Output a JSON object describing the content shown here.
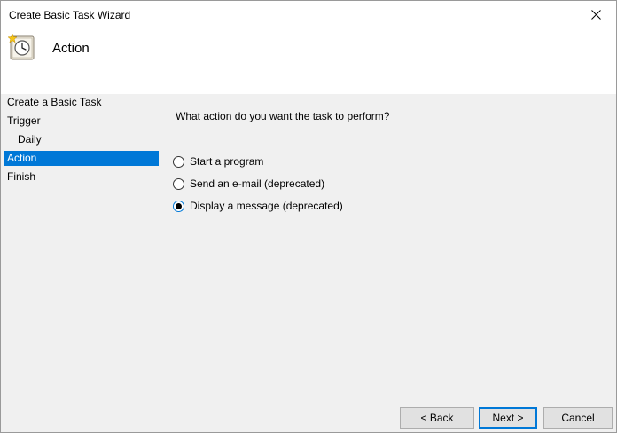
{
  "window": {
    "title": "Create Basic Task Wizard"
  },
  "header": {
    "title": "Action",
    "icon": "task-scheduler-clock-icon"
  },
  "sidebar": {
    "items": [
      {
        "label": "Create a Basic Task",
        "active": false
      },
      {
        "label": "Trigger",
        "active": false
      },
      {
        "label": "Daily",
        "active": false,
        "indent": true
      },
      {
        "label": "Action",
        "active": true
      },
      {
        "label": "Finish",
        "active": false
      }
    ]
  },
  "main": {
    "question": "What action do you want the task to perform?",
    "options": [
      {
        "label": "Start a program",
        "checked": false
      },
      {
        "label": "Send an e-mail (deprecated)",
        "checked": false
      },
      {
        "label": "Display a message (deprecated)",
        "checked": true
      }
    ]
  },
  "buttons": {
    "back": "< Back",
    "next": "Next >",
    "cancel": "Cancel"
  },
  "colors": {
    "accent": "#0078d7",
    "panel": "#f0f0f0"
  }
}
